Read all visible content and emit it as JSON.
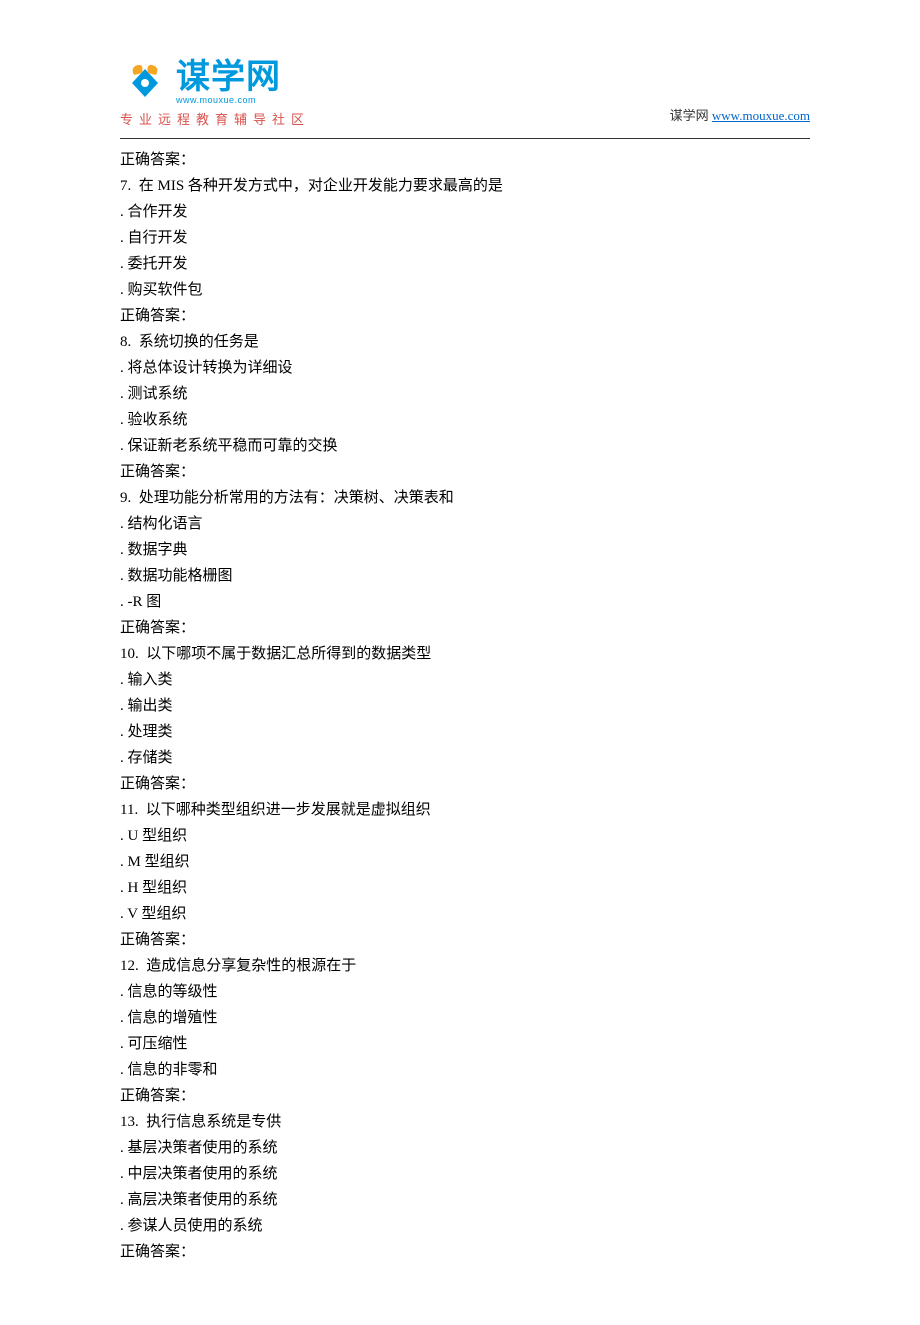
{
  "header": {
    "logo_cn": "谋学网",
    "logo_url": "www.mouxue.com",
    "tagline": "专业远程教育辅导社区",
    "right_prefix": "谋学网 ",
    "right_link_text": "www.mouxue.com",
    "right_link_href": "http://www.mouxue.com"
  },
  "answer_label": "正确答案：",
  "questions": [
    {
      "num": "7.",
      "stem": "在 MIS 各种开发方式中，对企业开发能力要求最高的是",
      "options": [
        "合作开发",
        "自行开发",
        "委托开发",
        "购买软件包"
      ],
      "prev_answer": true
    },
    {
      "num": "8.",
      "stem": "系统切换的任务是",
      "options": [
        "将总体设计转换为详细设",
        "测试系统",
        "验收系统",
        "保证新老系统平稳而可靠的交换"
      ]
    },
    {
      "num": "9.",
      "stem": "处理功能分析常用的方法有：决策树、决策表和",
      "options": [
        "结构化语言",
        "数据字典",
        "数据功能格栅图",
        "-R 图"
      ]
    },
    {
      "num": "10.",
      "stem": "以下哪项不属于数据汇总所得到的数据类型",
      "options": [
        "输入类",
        "输出类",
        "处理类",
        "存储类"
      ]
    },
    {
      "num": "11.",
      "stem": "以下哪种类型组织进一步发展就是虚拟组织",
      "options": [
        "U 型组织",
        "M 型组织",
        "H 型组织",
        "V 型组织"
      ]
    },
    {
      "num": "12.",
      "stem": "造成信息分享复杂性的根源在于",
      "options": [
        "信息的等级性",
        "信息的增殖性",
        "可压缩性",
        "信息的非零和"
      ]
    },
    {
      "num": "13.",
      "stem": "执行信息系统是专供",
      "options": [
        "基层决策者使用的系统",
        "中层决策者使用的系统",
        "高层决策者使用的系统",
        "参谋人员使用的系统"
      ]
    }
  ]
}
